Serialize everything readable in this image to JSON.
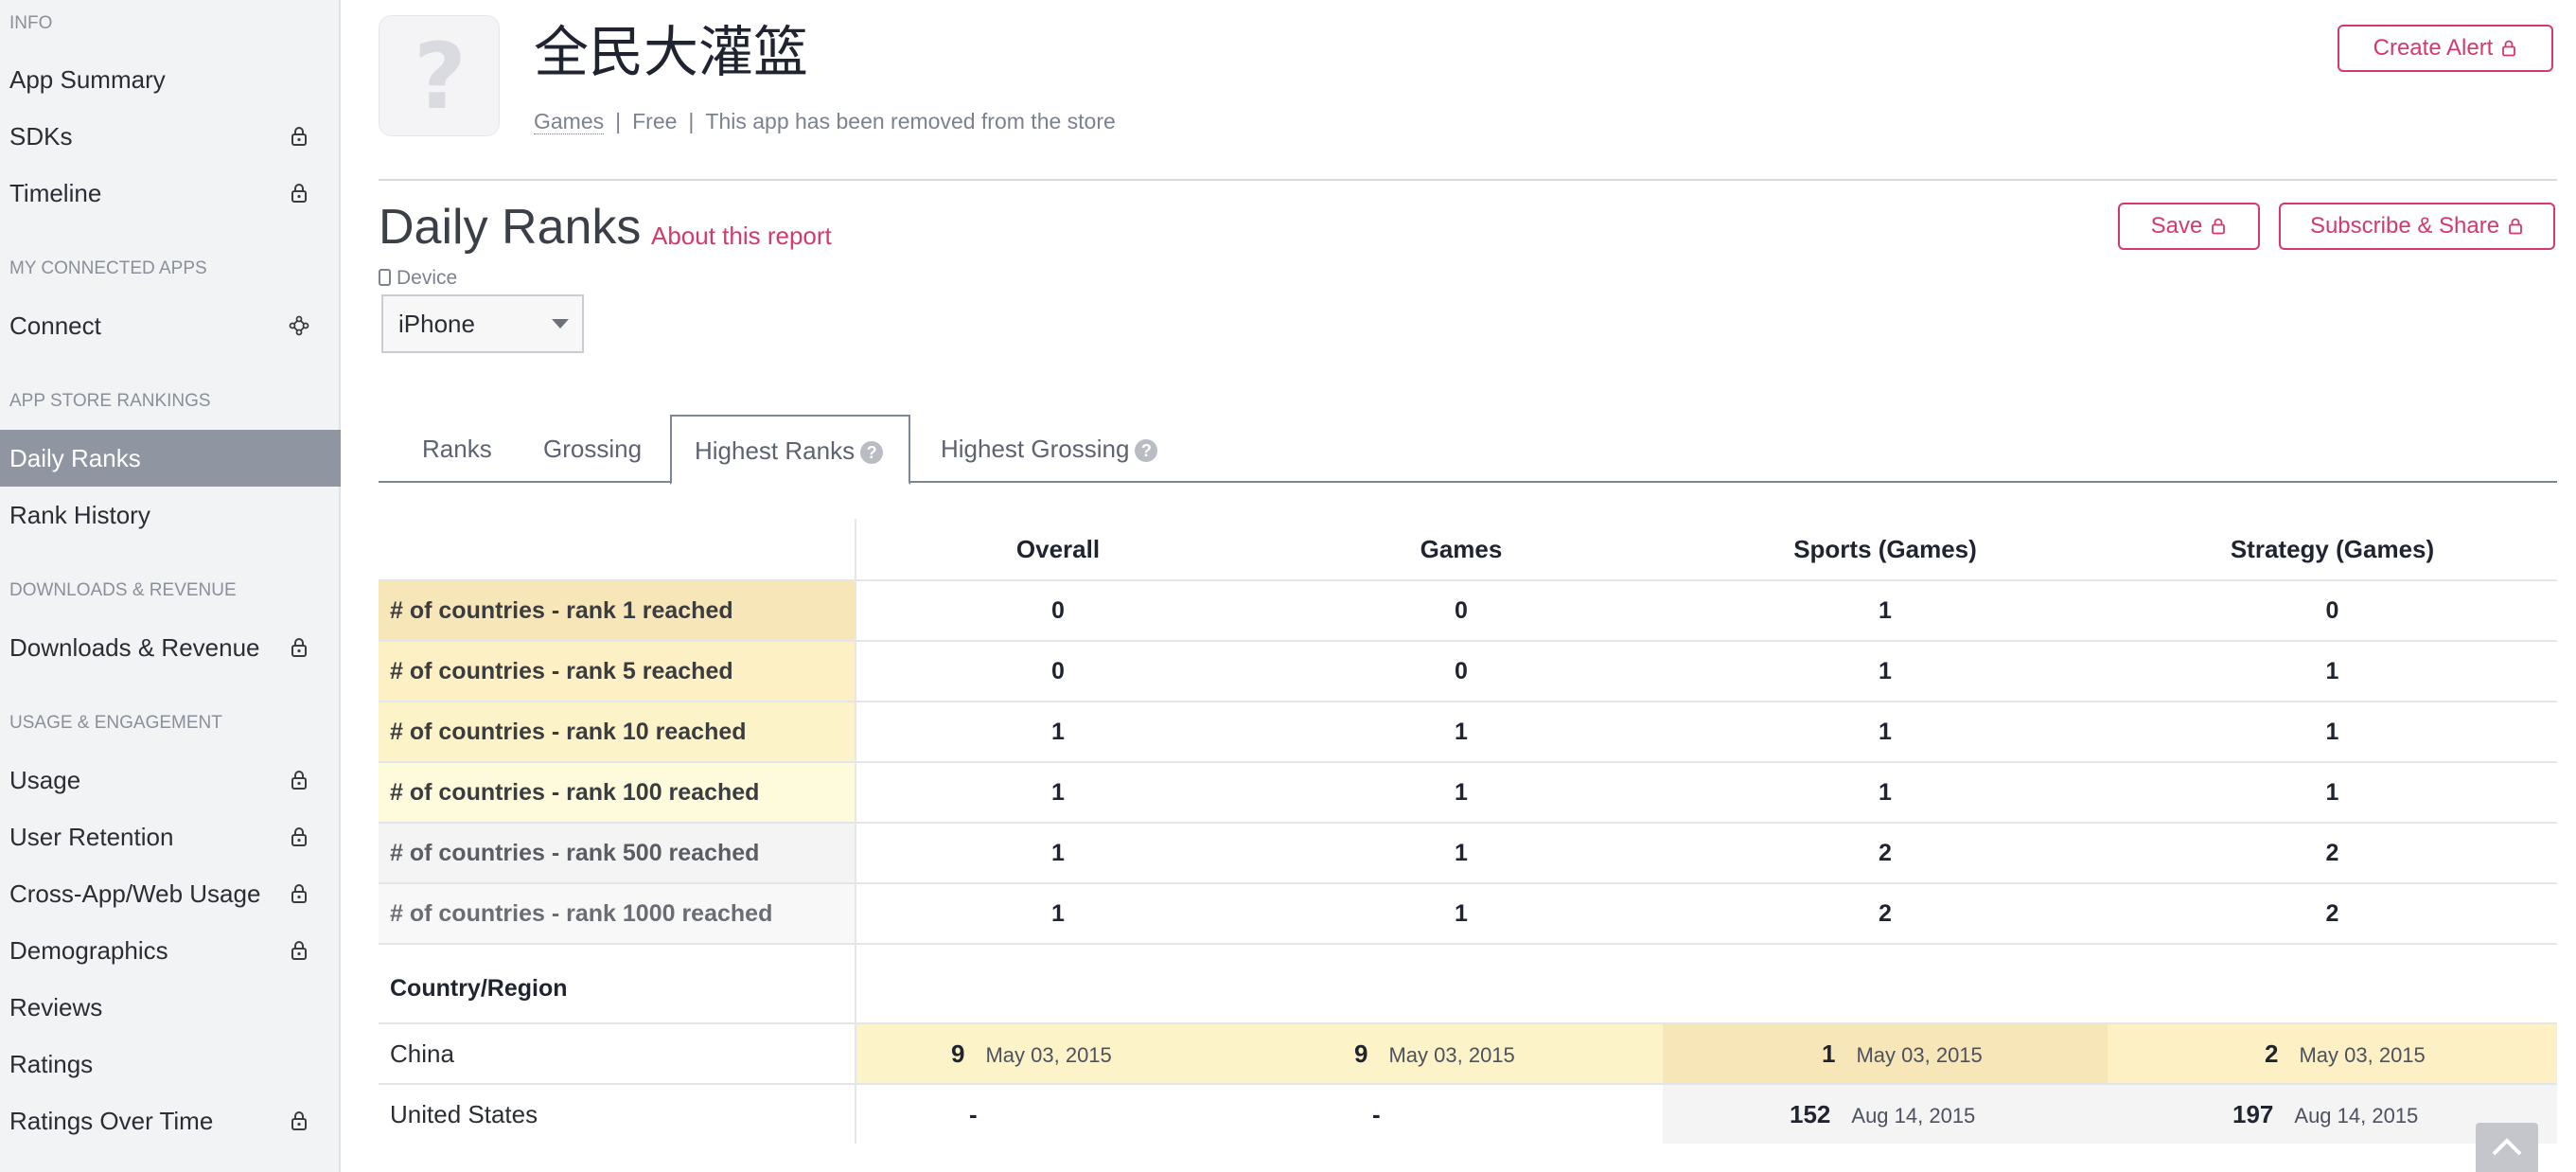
{
  "sidebar": {
    "sections": {
      "info": "INFO",
      "connected": "MY CONNECTED APPS",
      "rankings": "APP STORE RANKINGS",
      "downloads": "DOWNLOADS & REVENUE",
      "usage": "USAGE & ENGAGEMENT"
    },
    "items": {
      "app_summary": "App Summary",
      "sdks": "SDKs",
      "timeline": "Timeline",
      "connect": "Connect",
      "daily_ranks": "Daily Ranks",
      "rank_history": "Rank History",
      "downloads_revenue": "Downloads & Revenue",
      "usage": "Usage",
      "user_retention": "User Retention",
      "cross_app": "Cross-App/Web Usage",
      "demographics": "Demographics",
      "reviews": "Reviews",
      "ratings": "Ratings",
      "ratings_over_time": "Ratings Over Time"
    }
  },
  "app": {
    "title": "全民大灌篮",
    "icon_glyph": "?",
    "category": "Games",
    "price": "Free",
    "separator": "|",
    "status": "This app has been removed from the store"
  },
  "header": {
    "create_alert": "Create Alert",
    "save": "Save",
    "subscribe_share": "Subscribe & Share"
  },
  "report": {
    "title": "Daily Ranks",
    "about": "About this report",
    "device_label": "Device",
    "device_value": "iPhone"
  },
  "tabs": {
    "ranks": "Ranks",
    "grossing": "Grossing",
    "highest_ranks": "Highest Ranks",
    "highest_grossing": "Highest Grossing",
    "help_glyph": "?"
  },
  "table": {
    "columns": [
      "Overall",
      "Games",
      "Sports (Games)",
      "Strategy (Games)"
    ],
    "rows": [
      {
        "label": "# of countries - rank 1 reached",
        "values": [
          "0",
          "0",
          "1",
          "0"
        ]
      },
      {
        "label": "# of countries - rank 5 reached",
        "values": [
          "0",
          "0",
          "1",
          "1"
        ]
      },
      {
        "label": "# of countries - rank 10 reached",
        "values": [
          "1",
          "1",
          "1",
          "1"
        ]
      },
      {
        "label": "# of countries - rank 100 reached",
        "values": [
          "1",
          "1",
          "1",
          "1"
        ]
      },
      {
        "label": "# of countries - rank 500 reached",
        "values": [
          "1",
          "1",
          "2",
          "2"
        ]
      },
      {
        "label": "# of countries - rank 1000 reached",
        "values": [
          "1",
          "1",
          "2",
          "2"
        ]
      }
    ],
    "country_header": "Country/Region",
    "countries": [
      {
        "name": "China",
        "cells": [
          {
            "rank": "9",
            "date": "May 03, 2015"
          },
          {
            "rank": "9",
            "date": "May 03, 2015"
          },
          {
            "rank": "1",
            "date": "May 03, 2015"
          },
          {
            "rank": "2",
            "date": "May 03, 2015"
          }
        ]
      },
      {
        "name": "United States",
        "cells": [
          {
            "rank": "-",
            "date": ""
          },
          {
            "rank": "-",
            "date": ""
          },
          {
            "rank": "152",
            "date": "Aug 14, 2015"
          },
          {
            "rank": "197",
            "date": "Aug 14, 2015"
          }
        ]
      }
    ]
  },
  "colors": {
    "accent": "#d33a6a",
    "sidebar_active": "#8f95a1",
    "rank1_bg": "#f7e6b8",
    "rank5_bg": "#fcf0c4",
    "rank10_bg": "#fdf3c8",
    "rank100_bg": "#fefbdc",
    "rank500_bg": "#f4f4f5",
    "rank1000_bg": "#f8f8f9"
  }
}
